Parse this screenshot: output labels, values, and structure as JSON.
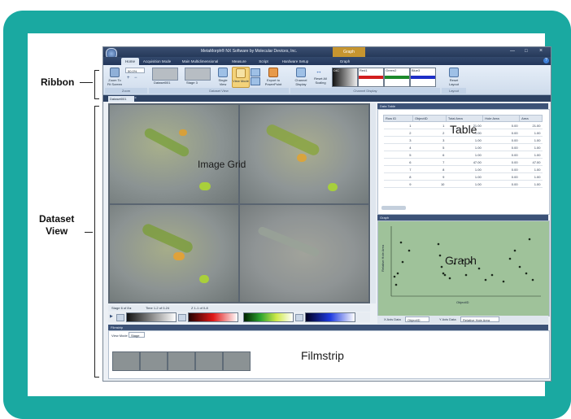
{
  "annotations": {
    "ribbon": "Ribbon",
    "dataset_view_line1": "Dataset",
    "dataset_view_line2": "View"
  },
  "app": {
    "title": "MetaMorph® NX Software by Molecular Devices, Inc.",
    "context_tab_group": "Graph",
    "tabs": [
      "Home",
      "Acquisition Mode",
      "Main Multidimensional",
      "Measure",
      "Script",
      "Hardware Setup",
      "Graph"
    ],
    "active_tab": "Home",
    "ribbon": {
      "zoom_value": "50.0%",
      "zoom_to_fit_label": "Zoom To Fit Screen",
      "dataset_name": "Dataset001",
      "stage_label": "Stage 3",
      "single_view_label": "Single View",
      "view_mode_label": "View Mode",
      "export_label": "Export to PowerPoint",
      "channel_display_label": "Channel Display",
      "reset_all_scaling_label": "Reset All Scaling",
      "channels": [
        "DIC",
        "Red1",
        "Green2",
        "Blue3"
      ],
      "reset_layout_label": "Reset Layout",
      "group_zoom": "Zoom",
      "group_dataset_view": "Dataset View",
      "group_channel_display": "Channel Display",
      "group_layout": "Layout"
    },
    "dataset_tab": "Dataset001",
    "image_grid": {
      "label": "Image Grid",
      "stage_readout": "Stage 6 of 8 ▸",
      "time_readout": "Time 1-2 of 0-24",
      "z_readout": "Z 1-1 of 0-8"
    },
    "data_table": {
      "panel_title": "Data Table",
      "label": "Table",
      "columns": [
        "Row ID",
        "ObjectID",
        "Total Area",
        "Hole Area",
        "Area"
      ],
      "rows": [
        [
          "1",
          "1",
          "21.00",
          "0.00",
          "21.00"
        ],
        [
          "2",
          "2",
          "1.00",
          "0.00",
          "1.00"
        ],
        [
          "3",
          "3",
          "1.00",
          "0.00",
          "1.00"
        ],
        [
          "4",
          "5",
          "1.00",
          "0.00",
          "1.00"
        ],
        [
          "5",
          "6",
          "1.00",
          "0.00",
          "1.00"
        ],
        [
          "6",
          "7",
          "47.00",
          "0.00",
          "47.00"
        ],
        [
          "7",
          "8",
          "1.00",
          "0.00",
          "1.00"
        ],
        [
          "8",
          "9",
          "1.00",
          "0.00",
          "1.00"
        ],
        [
          "9",
          "10",
          "1.00",
          "0.00",
          "1.00"
        ]
      ]
    },
    "graph": {
      "panel_title": "Graph",
      "label": "Graph",
      "x_axis_title": "ObjectID",
      "y_axis_title": "Relative Hole Area",
      "x_axis_data_label": "X Axis Data",
      "x_axis_data_value": "ObjectID",
      "y_axis_data_label": "Y Axis Data",
      "y_axis_data_value": "Relative Hole Area"
    },
    "filmstrip": {
      "panel_title": "Filmstrip",
      "label": "Filmstrip",
      "view_mode_label": "View Mode",
      "view_mode_value": "Stage"
    }
  },
  "colors": {
    "frame": "#1aa9a1",
    "graph_bg": "#9fc29a",
    "app_chrome": "#2d4263"
  }
}
